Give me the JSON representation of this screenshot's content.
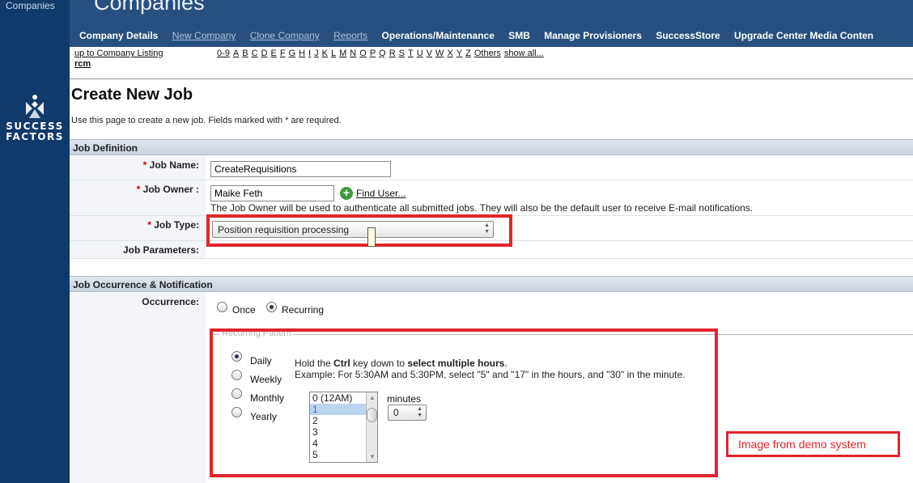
{
  "rail": {
    "label": "Companies",
    "logo_line1": "SUCCESS",
    "logo_line2": "FACTORS"
  },
  "header": {
    "title": "Companies",
    "nav": [
      {
        "label": "Company Details",
        "link": false
      },
      {
        "label": "New Company",
        "link": true
      },
      {
        "label": "Clone Company",
        "link": true
      },
      {
        "label": "Reports",
        "link": true
      },
      {
        "label": "Operations/Maintenance",
        "link": false
      },
      {
        "label": "SMB",
        "link": false
      },
      {
        "label": "Manage Provisioners",
        "link": false
      },
      {
        "label": "SuccessStore",
        "link": false
      },
      {
        "label": "Upgrade Center Media Conten",
        "link": false
      }
    ]
  },
  "listing": {
    "up_link": "up to Company Listing",
    "company": "rcm",
    "letters": [
      "0-9",
      "A",
      "B",
      "C",
      "D",
      "E",
      "F",
      "G",
      "H",
      "I",
      "J",
      "K",
      "L",
      "M",
      "N",
      "O",
      "P",
      "Q",
      "R",
      "S",
      "T",
      "U",
      "V",
      "W",
      "X",
      "Y",
      "Z",
      "Others",
      "show all..."
    ]
  },
  "page": {
    "title": "Create New Job",
    "description": "Use this page to create a new job. Fields marked with * are required."
  },
  "job_definition": {
    "section_title": "Job Definition",
    "required_marker": "*",
    "job_name_label": "Job Name:",
    "job_name_value": "CreateRequisitions",
    "job_owner_label": "Job Owner :",
    "job_owner_value": "Maike Feth",
    "find_user": "Find User...",
    "owner_note": "The Job Owner will be used to authenticate all submitted jobs. They will also be the default user to receive E-mail notifications.",
    "job_type_label": "Job Type:",
    "job_type_value": "Position requisition processing",
    "job_params_label": "Job Parameters:"
  },
  "occurrence": {
    "section_title": "Job Occurrence & Notification",
    "label": "Occurrence:",
    "once": "Once",
    "recurring": "Recurring",
    "selected": "Recurring",
    "pattern_legend": "Recurring Pattern",
    "patterns": [
      "Daily",
      "Weekly",
      "Monthly",
      "Yearly"
    ],
    "selected_pattern": "Daily",
    "hint_pre": "Hold the ",
    "hint_key": "Ctrl",
    "hint_mid": " key down to ",
    "hint_bold": "select multiple hours",
    "hint_end": ".",
    "example": "Example: For 5:30AM and 5:30PM, select \"5\" and \"17\" in the hours, and \"30\" in the minute.",
    "hours": [
      "0 (12AM)",
      "1",
      "2",
      "3",
      "4",
      "5"
    ],
    "selected_hour": "1",
    "minutes_label": "minutes",
    "minutes_value": "0"
  },
  "annotation": "Image from demo system"
}
